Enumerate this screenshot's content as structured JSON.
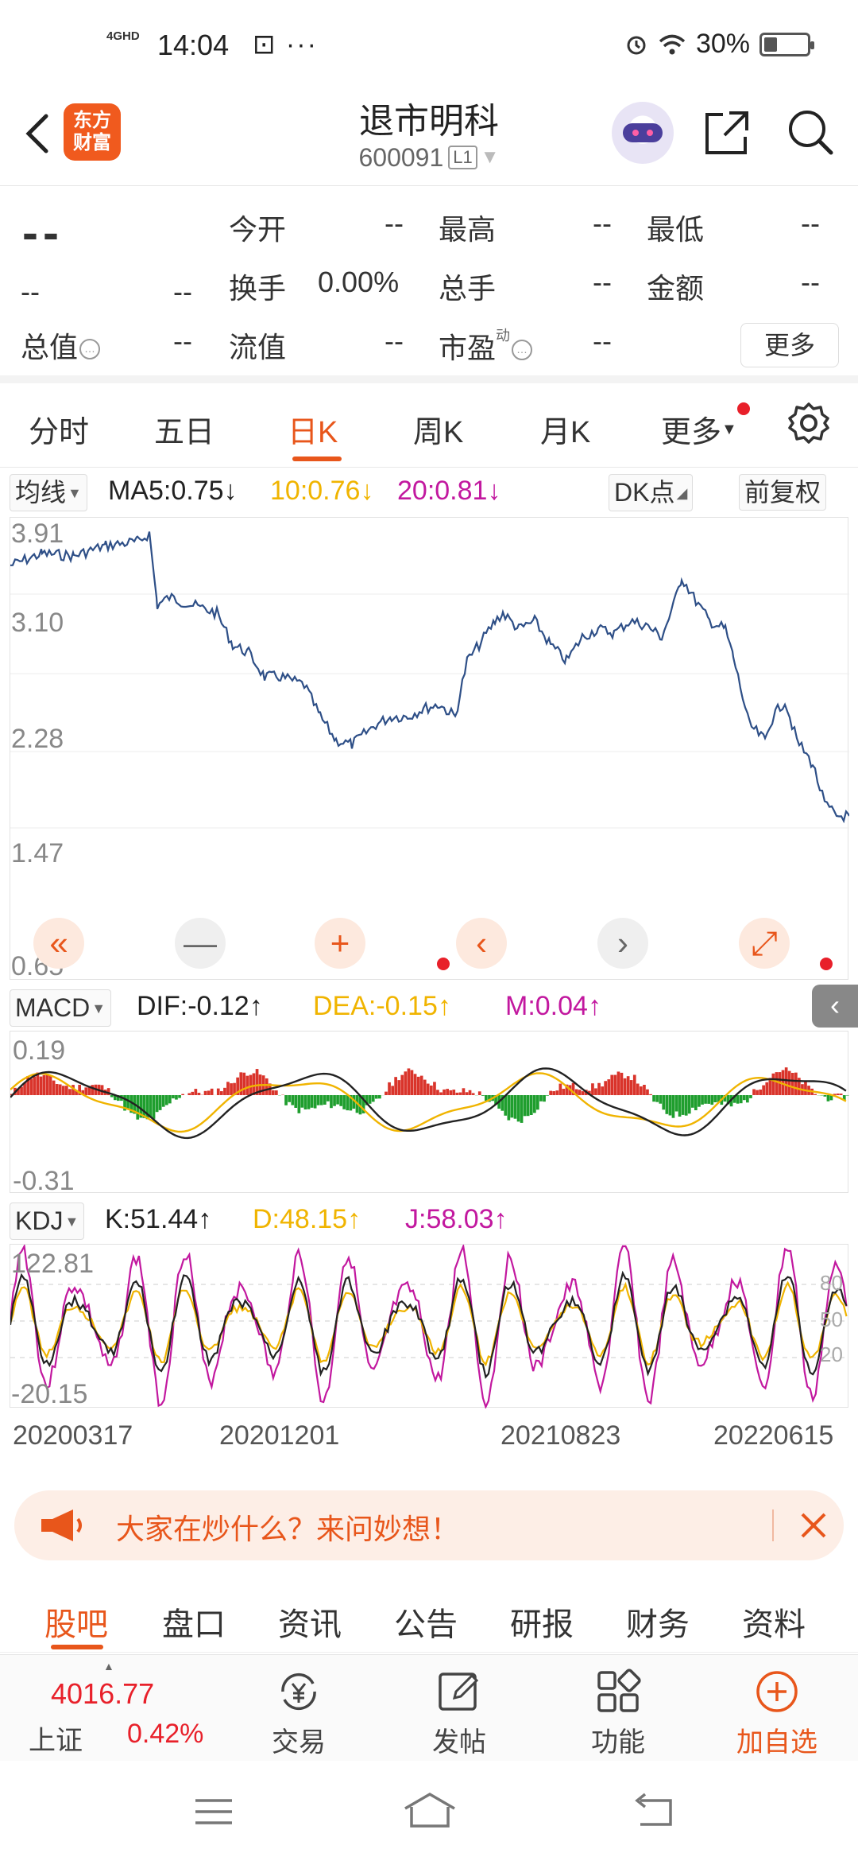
{
  "status": {
    "network": "4GHD",
    "time": "14:04",
    "extra": "⊡ ···",
    "battery": "30%",
    "battery_level": 0.3
  },
  "header": {
    "logo": "东方\n财富",
    "title": "退市明科",
    "code": "600091",
    "level": "L1"
  },
  "quote": {
    "price": "--",
    "change": "--",
    "change_pct": "--",
    "fields": [
      {
        "label": "今开",
        "value": "--"
      },
      {
        "label": "最高",
        "value": "--"
      },
      {
        "label": "最低",
        "value": "--"
      },
      {
        "label": "换手",
        "value": "0.00%"
      },
      {
        "label": "总手",
        "value": "--"
      },
      {
        "label": "金额",
        "value": "--"
      },
      {
        "label": "总值",
        "value": "--"
      },
      {
        "label": "流值",
        "value": "--"
      },
      {
        "label": "市盈",
        "value": "--",
        "sup": "动"
      }
    ],
    "more": "更多"
  },
  "tabs": [
    "分时",
    "五日",
    "日K",
    "周K",
    "月K",
    "更多"
  ],
  "active_tab": "日K",
  "ma": {
    "label": "均线",
    "ma5": "MA5:0.75↓",
    "ma10": "10:0.76↓",
    "ma20": "20:0.81↓",
    "dk": "DK点",
    "fq": "前复权",
    "colors": {
      "ma5": "#222222",
      "ma10": "#f0b400",
      "ma20": "#c2189f"
    }
  },
  "kline": {
    "y_labels": [
      "3.91",
      "3.10",
      "2.28",
      "1.47",
      "0.65"
    ],
    "line_color": "#2e4f87"
  },
  "macd": {
    "label": "MACD",
    "dif": "DIF:-0.12↑",
    "dea": "DEA:-0.15↑",
    "m": "M:0.04↑",
    "y_labels": [
      "0.19",
      "-0.31"
    ]
  },
  "kdj": {
    "label": "KDJ",
    "k": "K:51.44↑",
    "d": "D:48.15↑",
    "j": "J:58.03↑",
    "y_labels": [
      "122.81",
      "-20.15"
    ],
    "right_labels": [
      "80",
      "50",
      "20"
    ]
  },
  "dates": [
    "20200317",
    "20201201",
    "20210823",
    "20220615"
  ],
  "controls": [
    "«",
    "—",
    "+",
    "‹",
    "›",
    "⤢"
  ],
  "banner": {
    "text": "大家在炒什么？来问妙想！"
  },
  "subtabs": [
    "股吧",
    "盘口",
    "资讯",
    "公告",
    "研报",
    "财务",
    "资料"
  ],
  "footer": {
    "index_value": "4016.77",
    "index_name": "上证",
    "index_pct": "0.42%",
    "items": [
      "交易",
      "发帖",
      "功能",
      "加自选"
    ]
  }
}
